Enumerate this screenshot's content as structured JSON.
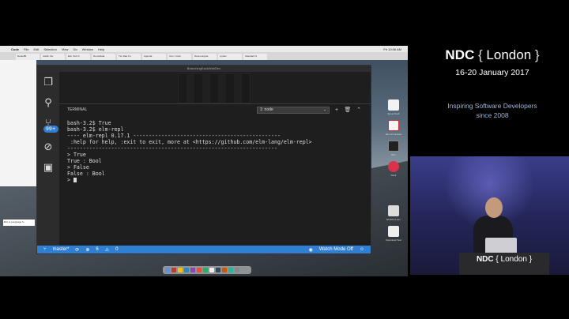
{
  "conference": {
    "name": "NDC",
    "city": "London",
    "dates": "16-20 January 2017",
    "tagline_line1": "Inspiring Software Developers",
    "tagline_line2": "since 2008"
  },
  "podium": {
    "name": "NDC",
    "city": "London"
  },
  "menubar": {
    "app": "Code",
    "items": [
      "File",
      "Edit",
      "Selection",
      "View",
      "Go",
      "Window",
      "Help"
    ],
    "clock": "Fri 10:06 AM"
  },
  "browser": {
    "tabs": [
      "DanielBr",
      "reddit: the",
      "Elm Tech F",
      "DemoData",
      "Tim Rao Fo",
      "Agenda",
      "Icon / code",
      "Dara Langua",
      "syntax",
      "Standard S"
    ],
    "status_text": "Elm is Language fo"
  },
  "vscode": {
    "title": "BranchingDuckWebDev",
    "panel_title": "TERMINAL",
    "terminal_select": "1: node",
    "terminal_lines": [
      "bash-3.2$ True",
      "bash-3.2$ elm-repl",
      "---- elm-repl 0.17.1 -----------------------------------------------",
      " :help for help, :exit to exit, more at <https://github.com/elm-lang/elm-repl>",
      "-------------------------------------------------------------------",
      "> True",
      "True : Bool",
      "> False",
      "False : Bool",
      "> "
    ],
    "badge": "99+",
    "status": {
      "branch": "master*",
      "errors": "6",
      "warnings": "0",
      "watch_mode": "Watch Mode Off"
    }
  },
  "desktop_icons": [
    "SpeechLab",
    "Elm-UI Feature",
    "Elm",
    "Deck",
    "ElmRCLI.elm",
    "Download Test"
  ],
  "colors": {
    "statusbar": "#2f7fd2",
    "tagline": "#9fb6d6",
    "terminal_bg": "#1e1e1e"
  }
}
